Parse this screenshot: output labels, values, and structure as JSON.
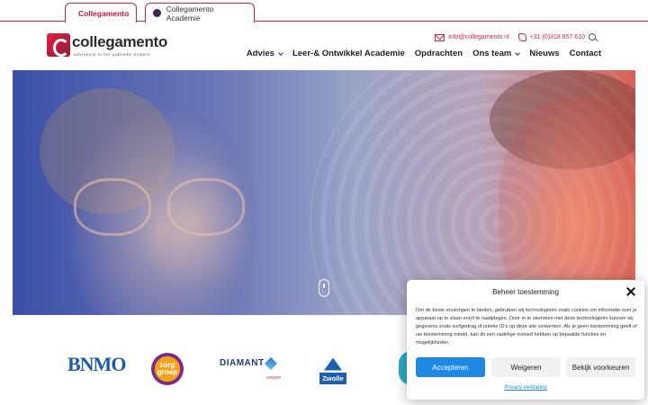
{
  "tabs": [
    {
      "label": "Collegamento",
      "active": true
    },
    {
      "label": "Collegamento Academie",
      "active": false
    }
  ],
  "logo": {
    "name": "collegamento",
    "tagline": "adviseurs in het publieke domein"
  },
  "contact": {
    "email": "info@collegamento.nl",
    "phone": "+31 (0)318 657 610"
  },
  "nav": [
    {
      "label": "Advies",
      "dropdown": true
    },
    {
      "label": "Leer-& Ontwikkel Academie",
      "dropdown": false
    },
    {
      "label": "Opdrachten",
      "dropdown": false
    },
    {
      "label": "Ons team",
      "dropdown": true
    },
    {
      "label": "Nieuws",
      "dropdown": false
    },
    {
      "label": "Contact",
      "dropdown": false
    }
  ],
  "partners": {
    "bnmo": "BNMO",
    "zorg": "zorg groep",
    "diamant": "DIAMANT",
    "diamant_sub": "GROEP",
    "zwolle": "Zwolle"
  },
  "cookie": {
    "title": "Beheer toestemming",
    "body": "Om de beste ervaringen te bieden, gebruiken wij technologieën zoals cookies om informatie over je apparaat op te slaan en/of te raadplegen. Door in te stemmen met deze technologieën kunnen wij gegevens zoals surfgedrag of unieke ID's op deze site verwerken. Als je geen toestemming geeft of uw toestemming intrekt, kan dit een nadelige invloed hebben op bepaalde functies en mogelijkheden.",
    "accept": "Accepteren",
    "decline": "Weigeren",
    "preferences": "Bekijk voorkeuren",
    "privacy": "Privacy verklaring"
  },
  "colors": {
    "brand": "#c9253c",
    "accept_button": "#1e88e5"
  }
}
